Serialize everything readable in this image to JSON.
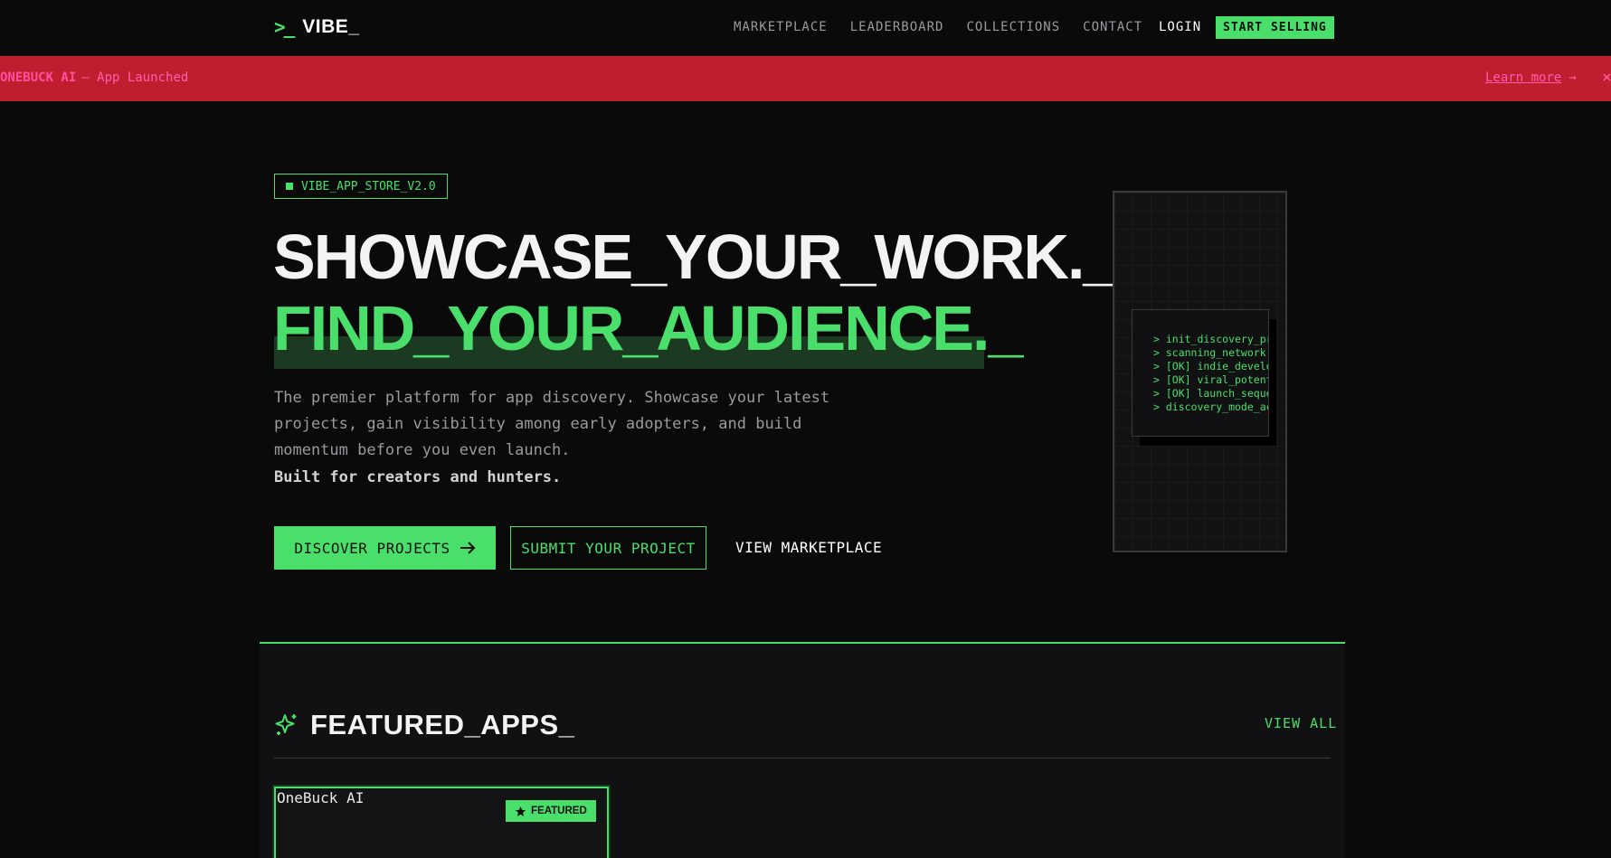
{
  "nav": {
    "logo_icon": ">_",
    "logo_text": "VIBE_",
    "links": [
      "MARKETPLACE",
      "LEADERBOARD",
      "COLLECTIONS",
      "CONTACT"
    ],
    "login": "LOGIN",
    "cta": "START SELLING"
  },
  "banner": {
    "app": "ONEBUCK AI",
    "message": "— App Launched",
    "link": "Learn more",
    "link_arrow": "→",
    "close": "×",
    "background": "#be1e2d",
    "text_color": "#ff5fae"
  },
  "hero": {
    "badge": "VIBE_APP_STORE_V2.0",
    "title_line1": "SHOWCASE_YOUR_WORK._",
    "title_line2": "FIND_YOUR_AUDIENCE._",
    "description": "The premier platform for app discovery. Showcase your latest projects, gain visibility among early adopters, and build momentum before you even launch.",
    "description_strong": "Built for creators and hunters.",
    "btn_discover": "DISCOVER PROJECTS",
    "btn_submit": "SUBMIT YOUR PROJECT",
    "btn_marketplace": "VIEW MARKETPLACE",
    "accent": "#4ade6a"
  },
  "terminal": {
    "lines": [
      "> init_discovery_pro",
      "> scanning_network..",
      "> [OK] indie_develop",
      "> [OK] viral_potenti",
      "> [OK] launch_sequen",
      "> discovery_mode_act"
    ]
  },
  "featured": {
    "title": "FEATURED_APPS_",
    "view_all": "VIEW ALL",
    "apps": [
      {
        "name": "OneBuck AI",
        "badge": "FEATURED"
      }
    ]
  }
}
